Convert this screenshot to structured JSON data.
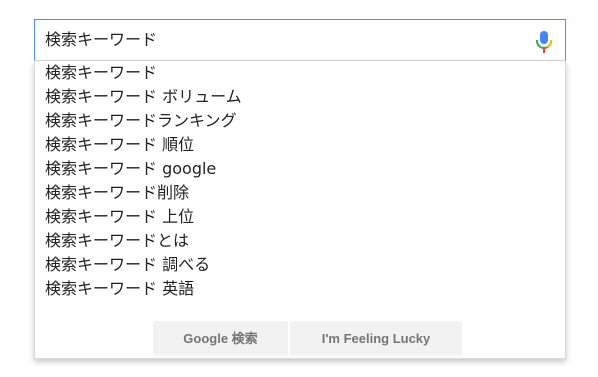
{
  "search": {
    "value": "検索キーワード"
  },
  "suggestions": [
    {
      "text": "検索キーワード"
    },
    {
      "text": "検索キーワード ボリューム"
    },
    {
      "text": "検索キーワードランキング"
    },
    {
      "text": "検索キーワード 順位"
    },
    {
      "text": "検索キーワード google"
    },
    {
      "text": "検索キーワード削除"
    },
    {
      "text": "検索キーワード 上位"
    },
    {
      "text": "検索キーワードとは"
    },
    {
      "text": "検索キーワード 調べる"
    },
    {
      "text": "検索キーワード 英語"
    }
  ],
  "buttons": {
    "search_label": "Google 検索",
    "lucky_label": "I'm Feeling Lucky"
  },
  "icons": {
    "mic": "microphone-icon"
  },
  "colors": {
    "focus_border": "#4d90fe",
    "mic_blue": "#4285f4",
    "mic_red": "#ea4335",
    "mic_yellow": "#fbbc05",
    "mic_green": "#34a853",
    "button_bg": "#f2f2f2",
    "button_text": "#757575"
  }
}
